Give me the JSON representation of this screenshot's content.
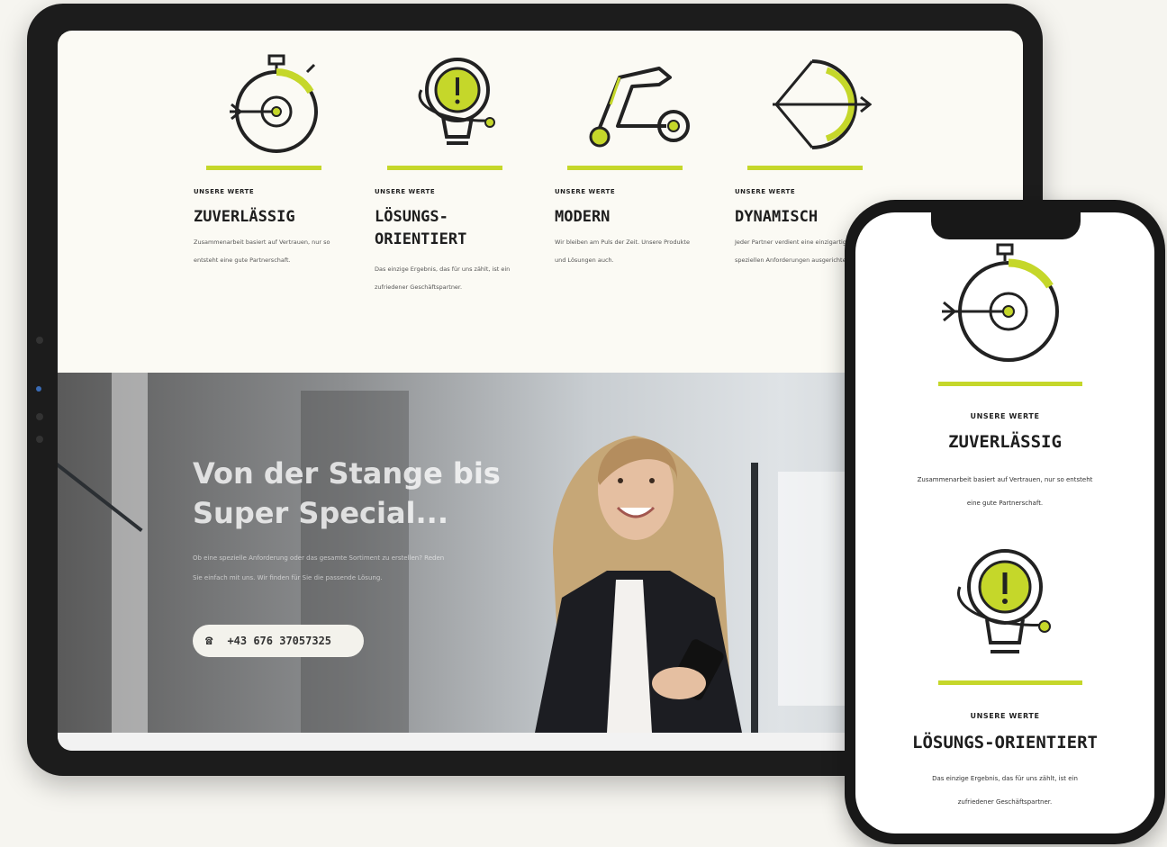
{
  "values": [
    {
      "kicker": "UNSERE WERTE",
      "title": "ZUVERLÄSSIG",
      "text": "Zusammenarbeit basiert auf Vertrauen, nur so entsteht eine gute Partnerschaft.",
      "icon": "stopwatch-target-icon"
    },
    {
      "kicker": "UNSERE WERTE",
      "title": "LÖSUNGS-ORIENTIERT",
      "text": "Das einzige Ergebnis, das für uns zählt, ist ein zufriedener Geschäftspartner.",
      "icon": "lightbulb-exclamation-icon"
    },
    {
      "kicker": "UNSERE WERTE",
      "title": "MODERN",
      "text": "Wir bleiben am Puls der Zeit. Unsere Produkte und Lösungen auch.",
      "icon": "flexed-arm-icon"
    },
    {
      "kicker": "UNSERE WERTE",
      "title": "DYNAMISCH",
      "text": "Jeder Partner verdient eine einzigartige, auf die speziellen Anforderungen ausgerichtete Lösung.",
      "icon": "bow-arrow-icon"
    }
  ],
  "hero": {
    "title_line1": "Von der Stange bis",
    "title_line2": "Super Special...",
    "text": "Ob eine spezielle Anforderung oder das gesamte Sortiment zu erstellen? Reden Sie einfach mit uns. Wir finden für Sie die passende Lösung.",
    "phone": "+43 676 37057325"
  },
  "mobile": {
    "items": [
      {
        "kicker": "UNSERE WERTE",
        "title": "ZUVERLÄSSIG",
        "text_line1": "Zusammenarbeit basiert auf Vertrauen, nur so entsteht",
        "text_line2": "eine gute Partnerschaft."
      },
      {
        "kicker": "UNSERE WERTE",
        "title": "LÖSUNGS-ORIENTIERT",
        "text_line1": "Das einzige Ergebnis, das für uns zählt, ist ein",
        "text_line2": "zufriedener Geschäftspartner."
      }
    ]
  },
  "colors": {
    "accent": "#c5d72a",
    "dark": "#1e1e1e",
    "page": "#fbfaf4"
  }
}
